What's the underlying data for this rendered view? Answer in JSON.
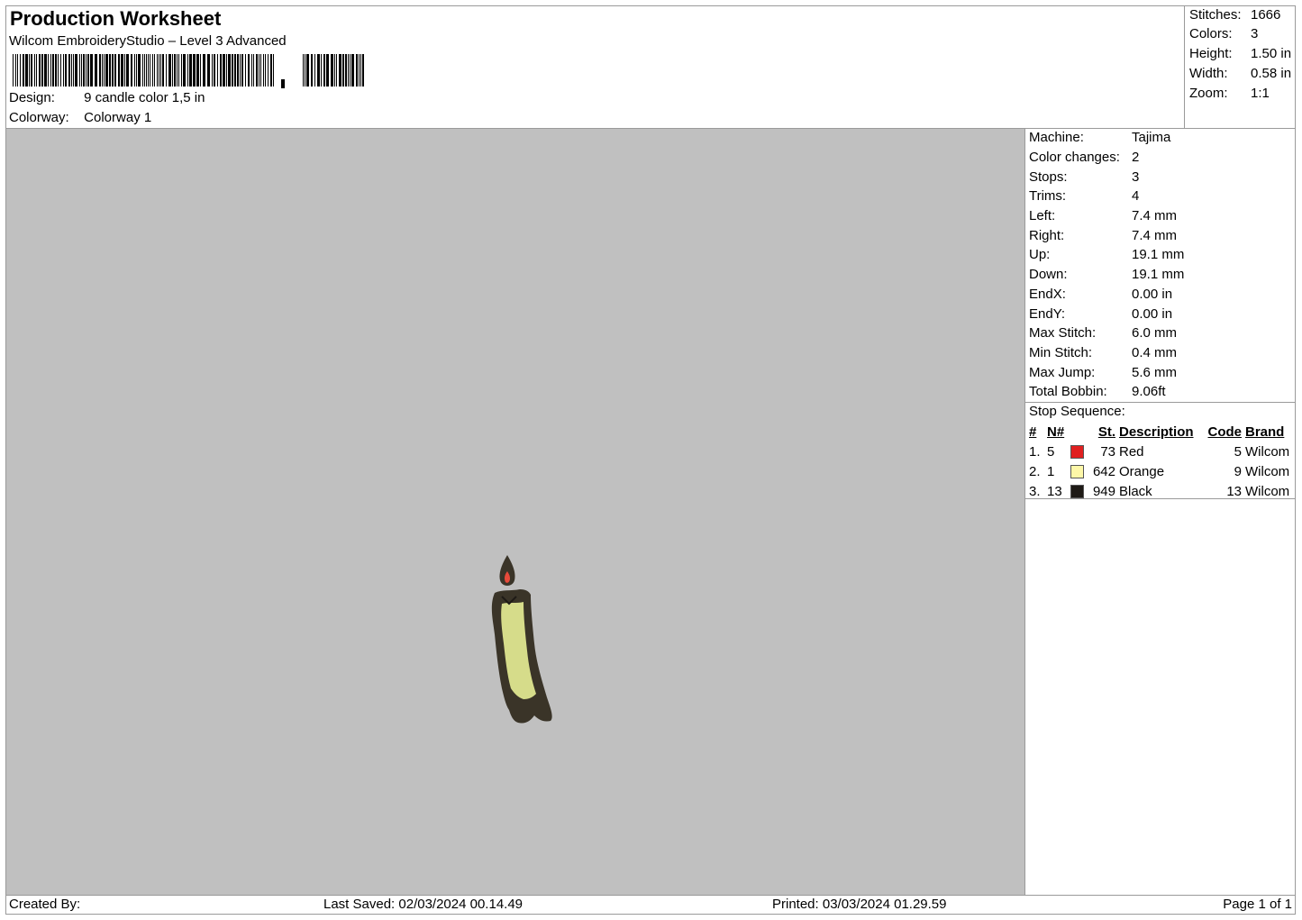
{
  "header": {
    "title": "Production Worksheet",
    "subtitle": "Wilcom EmbroideryStudio – Level 3 Advanced",
    "design_label": "Design:",
    "design_value": "9 candle color 1,5 in",
    "colorway_label": "Colorway:",
    "colorway_value": "Colorway 1"
  },
  "stats": [
    {
      "label": "Stitches:",
      "value": "1666"
    },
    {
      "label": "Colors:",
      "value": "3"
    },
    {
      "label": "Height:",
      "value": "1.50 in"
    },
    {
      "label": "Width:",
      "value": "0.58 in"
    },
    {
      "label": "Zoom:",
      "value": "1:1"
    }
  ],
  "machine": [
    {
      "label": "Machine:",
      "value": "Tajima"
    },
    {
      "label": "Color changes:",
      "value": "2"
    },
    {
      "label": "Stops:",
      "value": "3"
    },
    {
      "label": "Trims:",
      "value": "4"
    },
    {
      "label": "Left:",
      "value": "7.4 mm"
    },
    {
      "label": "Right:",
      "value": "7.4 mm"
    },
    {
      "label": "Up:",
      "value": "19.1 mm"
    },
    {
      "label": "Down:",
      "value": "19.1 mm"
    },
    {
      "label": "EndX:",
      "value": "0.00 in"
    },
    {
      "label": "EndY:",
      "value": "0.00 in"
    },
    {
      "label": "Max Stitch:",
      "value": "6.0 mm"
    },
    {
      "label": "Min Stitch:",
      "value": "0.4 mm"
    },
    {
      "label": "Max Jump:",
      "value": "5.6 mm"
    },
    {
      "label": "Total Bobbin:",
      "value": "9.06ft"
    }
  ],
  "stop_sequence": {
    "title": "Stop Sequence:",
    "columns": [
      "#",
      "N#",
      "St.",
      "Description",
      "Code",
      "Brand"
    ],
    "rows": [
      {
        "idx": "1.",
        "n": "5",
        "color": "#e02020",
        "st": "73",
        "desc": "Red",
        "code": "5",
        "brand": "Wilcom"
      },
      {
        "idx": "2.",
        "n": "1",
        "color": "#fdf7a8",
        "st": "642",
        "desc": "Orange",
        "code": "9",
        "brand": "Wilcom"
      },
      {
        "idx": "3.",
        "n": "13",
        "color": "#1e1a16",
        "st": "949",
        "desc": "Black",
        "code": "13",
        "brand": "Wilcom"
      }
    ]
  },
  "footer": {
    "created_by": "Created By:",
    "last_saved": "Last Saved: 02/03/2024 00.14.49",
    "printed": "Printed: 03/03/2024 01.29.59",
    "page": "Page 1 of 1"
  },
  "colors": {
    "canvas_bg": "#c0c0c0",
    "candle_outline": "#3a3428",
    "candle_fill": "#d6dc8a",
    "flame": "#e84a3a"
  }
}
